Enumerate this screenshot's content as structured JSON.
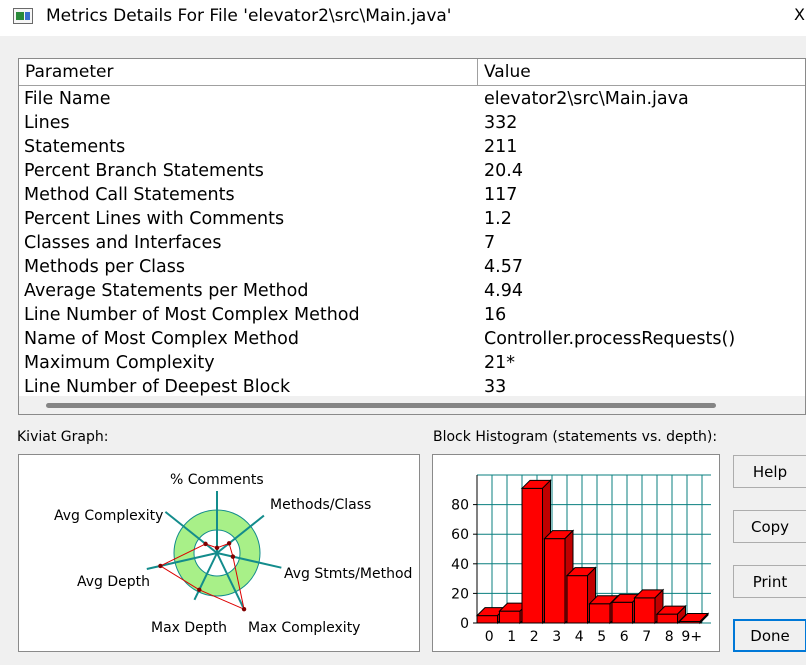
{
  "window": {
    "title": "Metrics Details For File 'elevator2\\src\\Main.java'",
    "close_glyph": "X"
  },
  "table": {
    "headers": {
      "parameter": "Parameter",
      "value": "Value"
    },
    "rows": [
      {
        "parameter": "File Name",
        "value": "elevator2\\src\\Main.java"
      },
      {
        "parameter": "Lines",
        "value": "332"
      },
      {
        "parameter": "Statements",
        "value": "211"
      },
      {
        "parameter": "Percent Branch Statements",
        "value": "20.4"
      },
      {
        "parameter": "Method Call Statements",
        "value": "117"
      },
      {
        "parameter": "Percent Lines with Comments",
        "value": "1.2"
      },
      {
        "parameter": "Classes and Interfaces",
        "value": "7"
      },
      {
        "parameter": "Methods per Class",
        "value": "4.57"
      },
      {
        "parameter": "Average Statements per Method",
        "value": "4.94"
      },
      {
        "parameter": "Line Number of Most Complex Method",
        "value": "16"
      },
      {
        "parameter": "Name of Most Complex Method",
        "value": "Controller.processRequests()"
      },
      {
        "parameter": "Maximum Complexity",
        "value": "21*"
      },
      {
        "parameter": "Line Number of Deepest Block",
        "value": "33"
      }
    ]
  },
  "kiviat": {
    "label": "Kiviat Graph:",
    "axes": [
      "% Comments",
      "Methods/Class",
      "Avg Stmts/Method",
      "Max Complexity",
      "Max Depth",
      "Avg Depth",
      "Avg Complexity"
    ],
    "values": [
      0.12,
      0.36,
      0.38,
      1.45,
      0.95,
      1.35,
      0.34
    ],
    "colors": {
      "ring": "#a8f088",
      "spoke": "#138c8c",
      "polygon": "#dd0000"
    }
  },
  "histogram": {
    "label": "Block Histogram (statements vs. depth):",
    "chart_data": {
      "type": "bar",
      "categories": [
        "0",
        "1",
        "2",
        "3",
        "4",
        "5",
        "6",
        "7",
        "8",
        "9+"
      ],
      "values": [
        5,
        8,
        91,
        57,
        32,
        13,
        14,
        17,
        6,
        1
      ],
      "yticks": [
        0,
        20,
        40,
        60,
        80
      ],
      "ylim": [
        0,
        100
      ],
      "grid": true,
      "bar_color": "#ff0000",
      "grid_color": "#0a7f7f"
    }
  },
  "buttons": {
    "help": "Help",
    "copy": "Copy",
    "print": "Print",
    "done": "Done"
  }
}
